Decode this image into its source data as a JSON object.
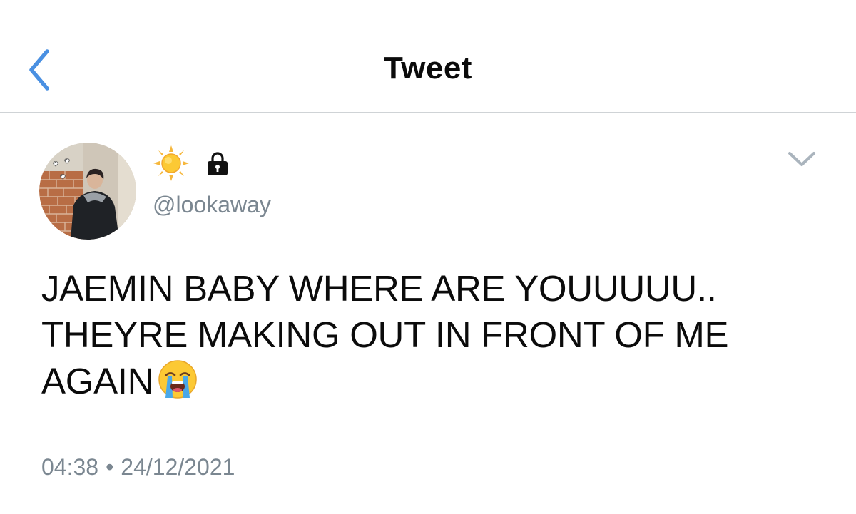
{
  "header": {
    "title": "Tweet",
    "back_icon": "chevron-left-icon"
  },
  "author": {
    "display_name_icons": [
      "sun-emoji-icon",
      "lock-icon"
    ],
    "handle": "@lookaway",
    "avatar_icon": "profile-photo"
  },
  "tweet": {
    "lines": [
      "JAEMIN BABY WHERE ARE YOUUUUU..",
      "THEYRE MAKING OUT IN FRONT OF ME",
      "AGAIN"
    ],
    "trailing_emoji": "loudly-crying-face-emoji-icon"
  },
  "meta": {
    "time": "04:38",
    "separator": "•",
    "date": "24/12/2021"
  },
  "colors": {
    "accent": "#4a90e2",
    "secondary_text": "#7b8791",
    "divider": "#cfd3d6",
    "primary_text": "#0b0b0b"
  }
}
